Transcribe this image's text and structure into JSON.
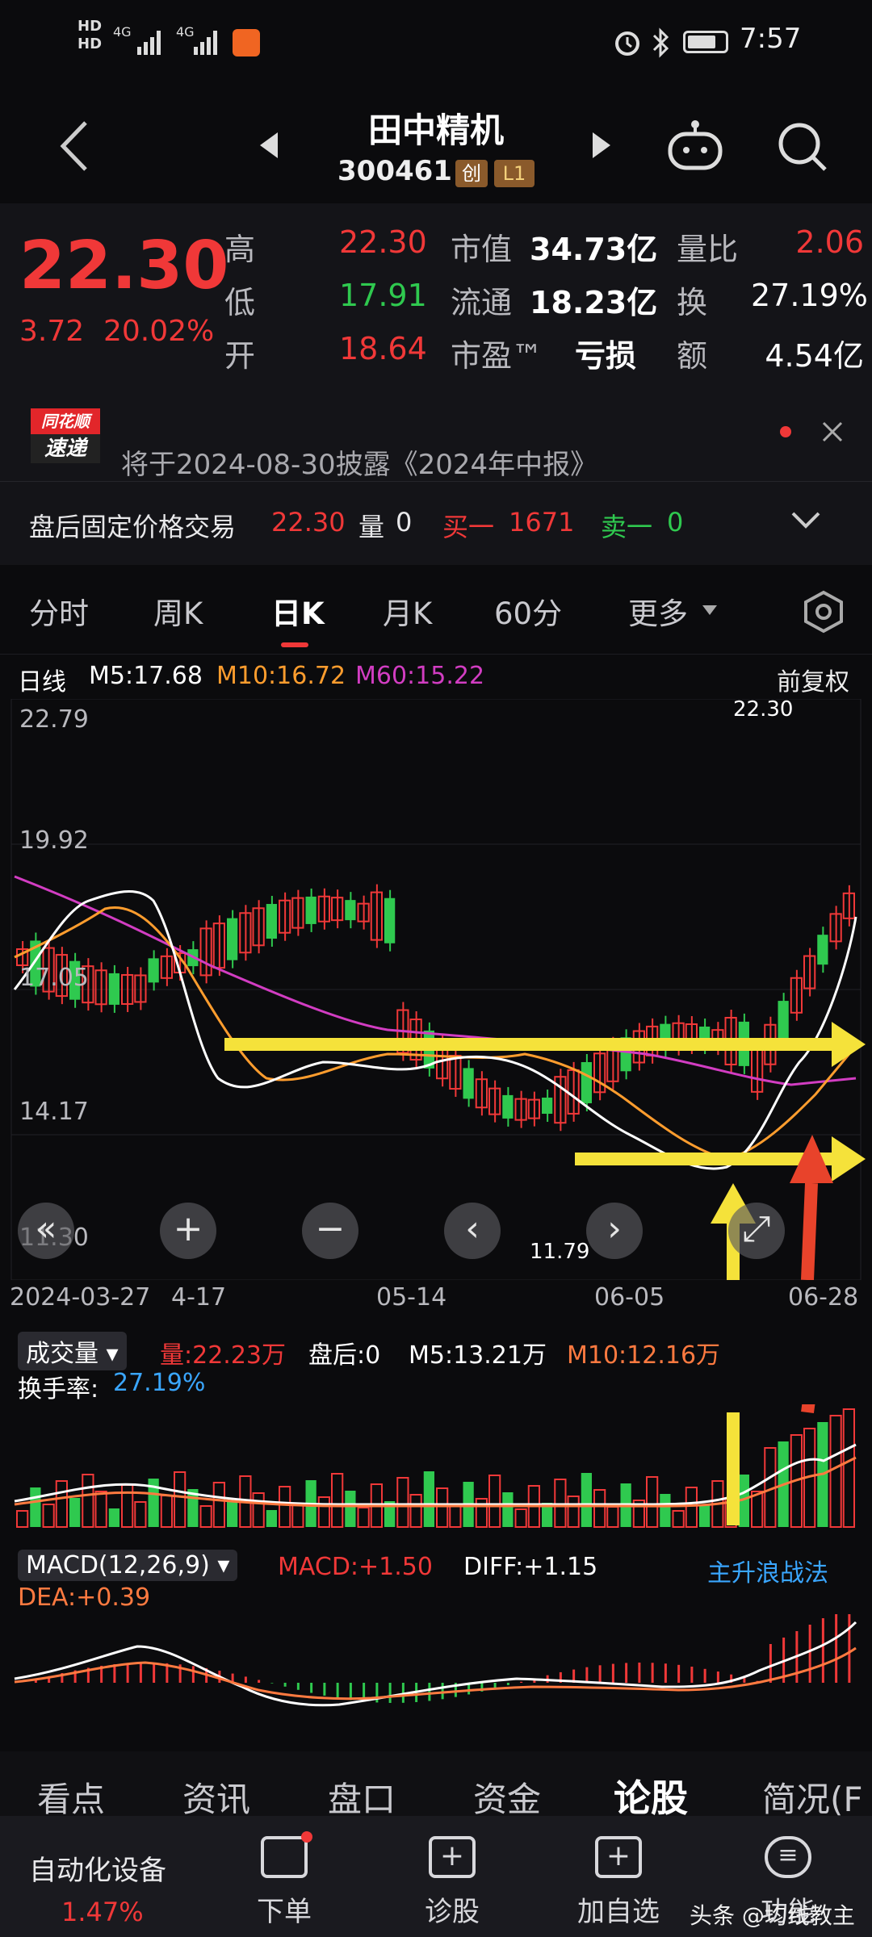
{
  "status_bar": {
    "time": "7:57",
    "network1": "4G",
    "network2": "4G",
    "hd1": "HD",
    "hd2": "HD"
  },
  "header": {
    "title": "田中精机",
    "code": "300461",
    "badge1": "创",
    "badge2": "L1"
  },
  "quote": {
    "price": "22.30",
    "change": "3.72",
    "change_pct": "20.02%",
    "high_label": "高",
    "high": "22.30",
    "low_label": "低",
    "low": "17.91",
    "open_label": "开",
    "open": "18.64",
    "mktcap_label": "市值",
    "mktcap": "34.73亿",
    "float_label": "流通",
    "float": "18.23亿",
    "pe_label": "市盈™",
    "pe": "亏损",
    "volratio_label": "量比",
    "volratio": "2.06",
    "turnover_label": "换",
    "turnover": "27.19%",
    "amount_label": "额",
    "amount": "4.54亿"
  },
  "notice": {
    "logo_top": "同花顺",
    "logo_bottom": "速递",
    "text": "将于2024-08-30披露《2024年中报》",
    "after_hours_label": "盘后固定价格交易",
    "after_hours_price": "22.30",
    "vol_label": "量",
    "vol": "0",
    "buy_label": "买一",
    "buy": "1671",
    "sell_label": "卖一",
    "sell": "0"
  },
  "tabs": [
    "分时",
    "周K",
    "日K",
    "月K",
    "60分",
    "更多"
  ],
  "active_tab": "日K",
  "kchart": {
    "legend_day": "日线",
    "m5": "M5:17.68",
    "m10": "M10:16.72",
    "m60": "M60:15.22",
    "adjust": "前复权",
    "y_labels": [
      "22.79",
      "19.92",
      "17.05",
      "14.17",
      "11.30"
    ],
    "high_label": "22.30",
    "low_label": "11.79",
    "dates": [
      "2024-03-27",
      "4-17",
      "05-14",
      "06-05",
      "06-28"
    ]
  },
  "volume": {
    "label": "成交量",
    "vol": "量:22.23万",
    "after": "盘后:0",
    "m5": "M5:13.21万",
    "m10": "M10:12.16万",
    "turnover_label": "换手率:",
    "turnover": "27.19%"
  },
  "macd": {
    "label": "MACD(12,26,9)",
    "macd": "MACD:+1.50",
    "diff": "DIFF:+1.15",
    "dea": "DEA:+0.39",
    "strategy": "主升浪战法"
  },
  "bottom_tabs": [
    "看点",
    "资讯",
    "盘口",
    "资金",
    "论股",
    "简况(F"
  ],
  "active_bottom_tab": "论股",
  "bottom_nav": {
    "sector": "自动化设备",
    "sector_pct": "1.47%",
    "order": "下单",
    "diagnose": "诊股",
    "watch": "加自选",
    "more": "功能"
  },
  "watermark": "头条 @均线教主",
  "chart_data": {
    "type": "candlestick",
    "title": "",
    "ylim": [
      11.3,
      22.79
    ],
    "x_labels": [
      "2024-03-27",
      "4-17",
      "05-14",
      "06-05",
      "06-28"
    ],
    "series": [
      {
        "name": "M5",
        "values": [
          17.68
        ]
      },
      {
        "name": "M10",
        "values": [
          16.72
        ]
      },
      {
        "name": "M60",
        "values": [
          15.22
        ]
      }
    ],
    "annotations": {
      "max": 22.3,
      "min": 11.79
    }
  },
  "colors": {
    "up": "#f03838",
    "down": "#2fc94f",
    "m5": "#ffffff",
    "m10": "#ff9d2e",
    "m60": "#d23dc2",
    "arrow_yellow": "#f5e23a",
    "arrow_red": "#e8432b"
  }
}
